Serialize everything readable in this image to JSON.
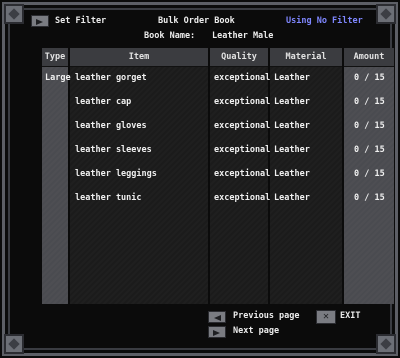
{
  "header": {
    "set_filter_label": "Set Filter",
    "title": "Bulk Order Book",
    "filter_status": "Using No Filter",
    "book_name_label": "Book Name:",
    "book_name": "Leather Male"
  },
  "table": {
    "columns": [
      "Type",
      "Item",
      "Quality",
      "Material",
      "Amount"
    ],
    "type_value": "Large",
    "rows": [
      {
        "item": "leather gorget",
        "quality": "exceptional",
        "material": "Leather",
        "amount": "0 / 15"
      },
      {
        "item": "leather cap",
        "quality": "exceptional",
        "material": "Leather",
        "amount": "0 / 15"
      },
      {
        "item": "leather gloves",
        "quality": "exceptional",
        "material": "Leather",
        "amount": "0 / 15"
      },
      {
        "item": "leather sleeves",
        "quality": "exceptional",
        "material": "Leather",
        "amount": "0 / 15"
      },
      {
        "item": "leather leggings",
        "quality": "exceptional",
        "material": "Leather",
        "amount": "0 / 15"
      },
      {
        "item": "leather tunic",
        "quality": "exceptional",
        "material": "Leather",
        "amount": "0 / 15"
      }
    ]
  },
  "footer": {
    "previous_page_label": "Previous page",
    "next_page_label": "Next page",
    "exit_label": "EXIT"
  }
}
